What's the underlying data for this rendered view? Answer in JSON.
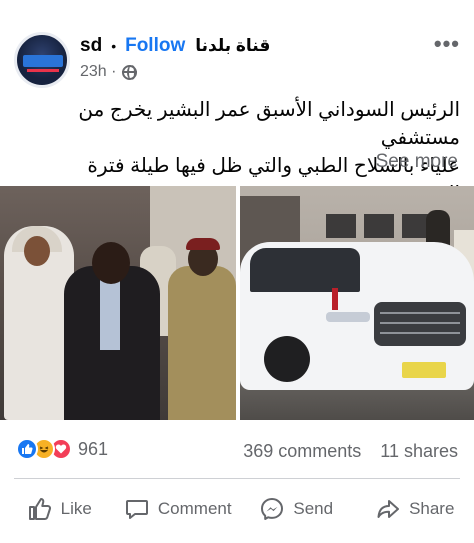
{
  "post": {
    "page_name": "sd",
    "separator": "•",
    "follow_label": "Follow",
    "page_name_arabic": "قناة بلدنا",
    "timestamp": "23h",
    "body_line_1": "الرئيس السوداني الأسبق عمر البشير يخرج من مستشفي",
    "body_line_2": "علياء بالسلاح الطبي والتي ظل فيها طيلة فترة الحرب....",
    "see_more_label": "See more"
  },
  "stats": {
    "reaction_count": "961",
    "comments": "369 comments",
    "shares": "11 shares"
  },
  "actions": {
    "like_label": "Like",
    "comment_label": "Comment",
    "send_label": "Send",
    "share_label": "Share"
  },
  "icons": {
    "more": "more-options-icon",
    "privacy": "globe-icon",
    "reactions": [
      "like-reaction-icon",
      "haha-reaction-icon",
      "love-reaction-icon"
    ]
  },
  "colors": {
    "accent": "#1877f2",
    "muted_text": "#65676b",
    "like": "#1877f2",
    "haha": "#f7b125",
    "love": "#f33e58"
  }
}
